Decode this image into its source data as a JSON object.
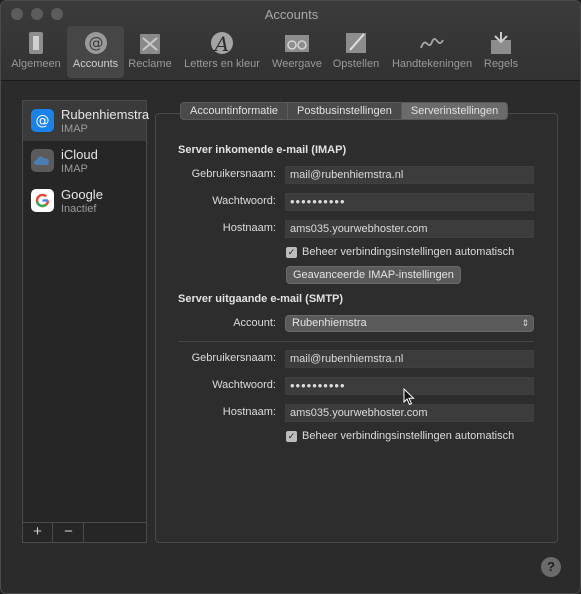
{
  "window": {
    "title": "Accounts"
  },
  "toolbar": {
    "items": [
      {
        "label": "Algemeen",
        "icon": "general-switch-icon"
      },
      {
        "label": "Accounts",
        "icon": "at-sign-icon"
      },
      {
        "label": "Reclame",
        "icon": "junk-mail-icon"
      },
      {
        "label": "Letters en kleur",
        "icon": "font-icon"
      },
      {
        "label": "Weergave",
        "icon": "viewing-glasses-icon"
      },
      {
        "label": "Opstellen",
        "icon": "compose-pen-icon"
      },
      {
        "label": "Handtekeningen",
        "icon": "signature-icon"
      },
      {
        "label": "Regels",
        "icon": "rules-envelope-icon"
      }
    ]
  },
  "sidebar": {
    "accounts": [
      {
        "name": "Rubenhiemstra",
        "type": "IMAP",
        "icon": "at-sign-icon",
        "color": "#1a82e8"
      },
      {
        "name": "iCloud",
        "type": "IMAP",
        "icon": "cloud-icon",
        "color": "#4a6f9a"
      },
      {
        "name": "Google",
        "type": "Inactief",
        "icon": "google-icon",
        "color": "#ffffff"
      }
    ],
    "add_label": "+",
    "remove_label": "−"
  },
  "tabs": [
    {
      "label": "Accountinformatie"
    },
    {
      "label": "Postbusinstellingen"
    },
    {
      "label": "Serverinstellingen"
    }
  ],
  "incoming": {
    "title": "Server inkomende e-mail (IMAP)",
    "username_label": "Gebruikersnaam:",
    "username": "mail@rubenhiemstra.nl",
    "password_label": "Wachtwoord:",
    "password": "••••••••••",
    "host_label": "Hostnaam:",
    "host": "ams035.yourwebhoster.com",
    "auto_label": "Beheer verbindingsinstellingen automatisch",
    "advanced_button": "Geavanceerde IMAP-instellingen"
  },
  "outgoing": {
    "title": "Server uitgaande e-mail (SMTP)",
    "account_label": "Account:",
    "account_value": "Rubenhiemstra",
    "username_label": "Gebruikersnaam:",
    "username": "mail@rubenhiemstra.nl",
    "password_label": "Wachtwoord:",
    "password": "••••••••••",
    "host_label": "Hostnaam:",
    "host": "ams035.yourwebhoster.com",
    "auto_label": "Beheer verbindingsinstellingen automatisch"
  },
  "help_label": "?"
}
